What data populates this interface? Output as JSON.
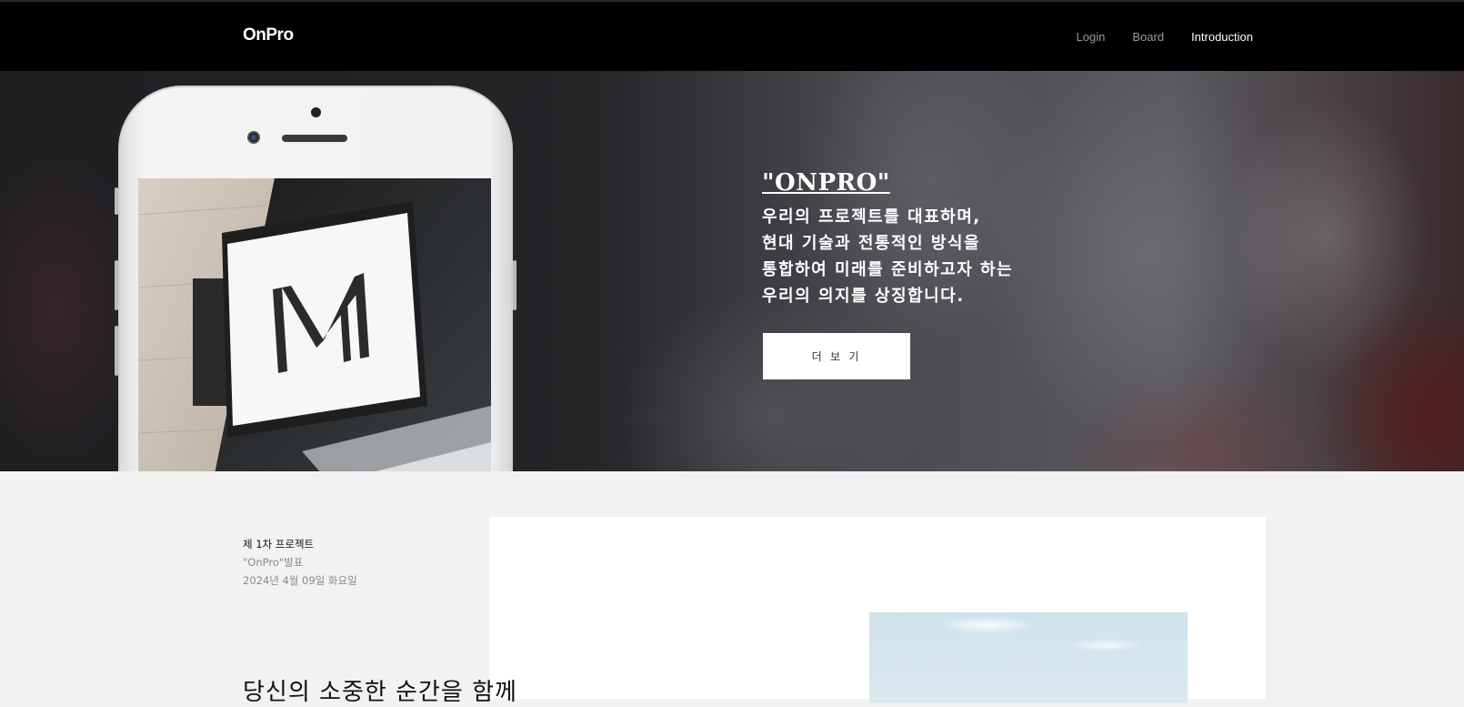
{
  "header": {
    "logo": "OnPro",
    "nav": [
      "Login",
      "Board",
      "Introduction"
    ]
  },
  "hero": {
    "title": "\"ONPRO\"",
    "lines": [
      "우리의 프로젝트를 대표하며,",
      "현대 기술과 전통적인 방식을",
      "통합하여 미래를 준비하고자 하는",
      "우리의 의지를 상징합니다."
    ],
    "button": "더 보 기"
  },
  "section": {
    "meta": [
      "제 1차 프로젝트",
      "\"OnPro\"발표",
      "2024년 4월 09일 화요일"
    ],
    "tagline": "당신의 소중한 순간을 함께"
  }
}
